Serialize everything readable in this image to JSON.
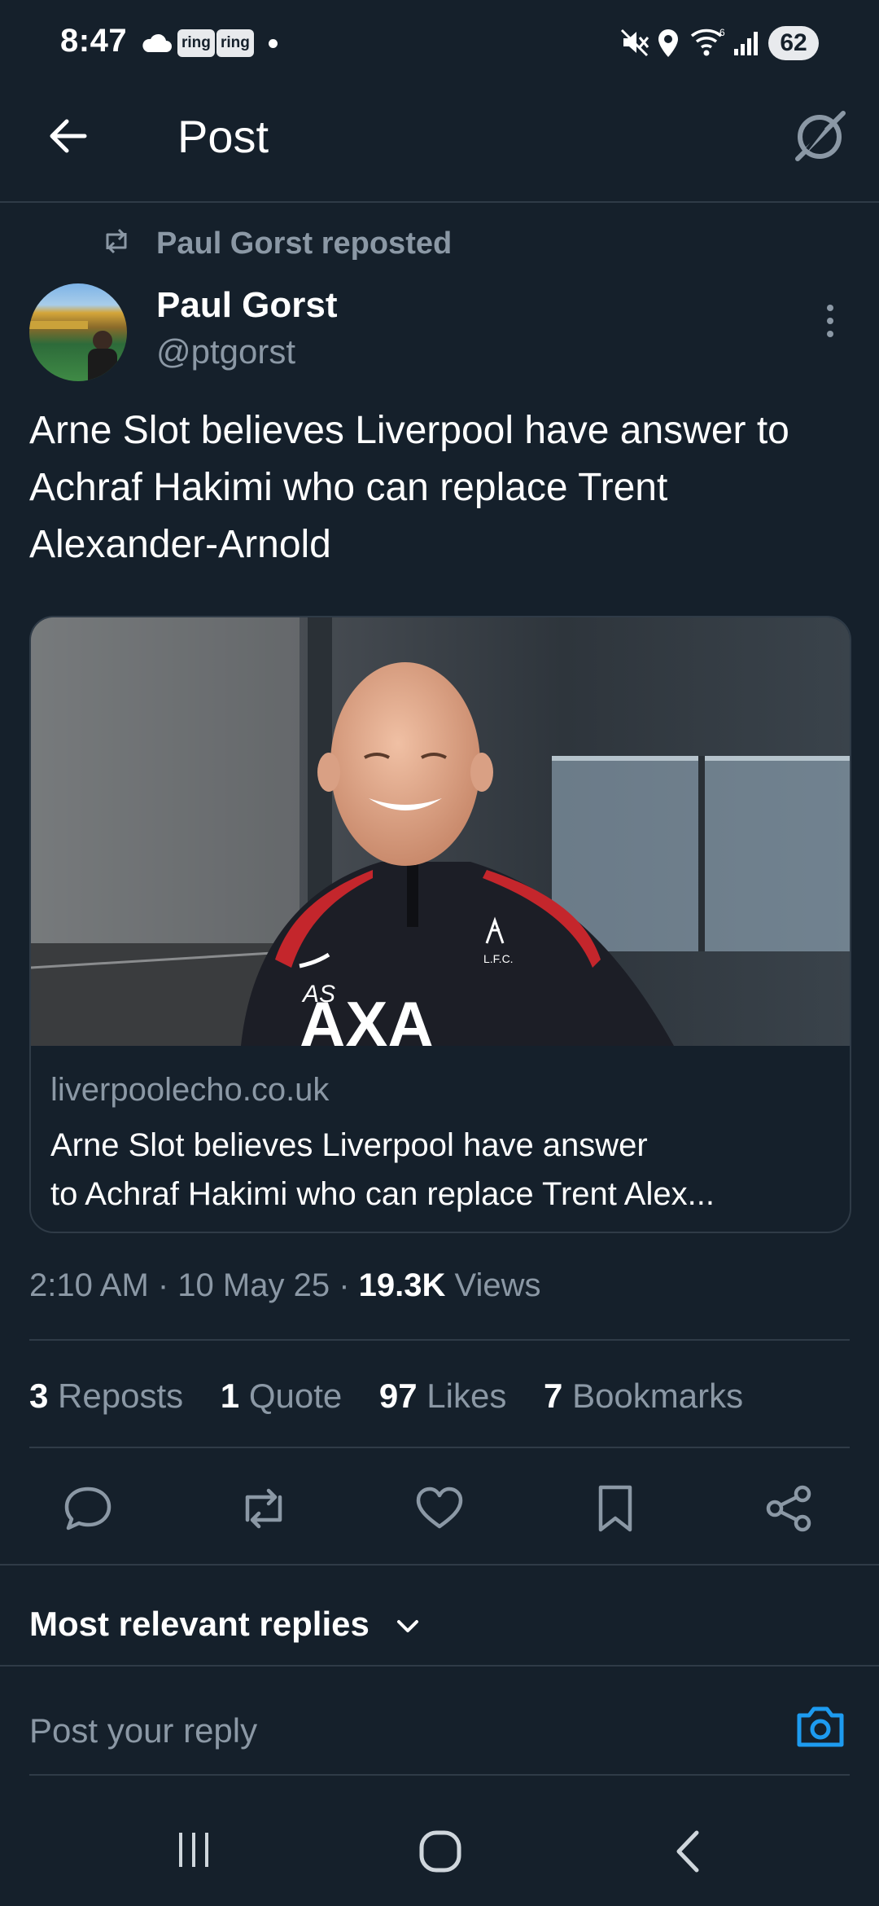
{
  "status_bar": {
    "time": "8:47",
    "ring_badge_1": "ring",
    "ring_badge_2": "ring",
    "battery": "62",
    "icons": [
      "cloud-icon",
      "ring-icon",
      "ring-icon",
      "dot-icon",
      "mute-icon",
      "location-icon",
      "wifi-icon",
      "signal-icon",
      "battery-icon"
    ]
  },
  "header": {
    "title": "Post",
    "back_icon": "back-arrow-icon",
    "grok_icon": "grok-icon"
  },
  "post": {
    "repost_label": "Paul Gorst reposted",
    "author_name": "Paul Gorst",
    "author_handle": "@ptgorst",
    "text": "Arne Slot believes Liverpool have answer to Achraf Hakimi who can replace Trent Alexander-Arnold",
    "card": {
      "domain": "liverpoolecho.co.uk",
      "title_line1": "Arne Slot believes Liverpool have answer",
      "title_line2": "to Achraf Hakimi who can replace Trent Alex...",
      "jacket_initials": "AS",
      "jacket_sponsor": "AXA",
      "jacket_crest": "L.F.C."
    },
    "timestamp": "2:10 AM · 10 May 25 · ",
    "views_count": "19.3K",
    "views_label": " Views",
    "stats": {
      "reposts_count": "3",
      "reposts_label": "Reposts",
      "quotes_count": "1",
      "quotes_label": "Quote",
      "likes_count": "97",
      "likes_label": "Likes",
      "bookmarks_count": "7",
      "bookmarks_label": "Bookmarks"
    }
  },
  "replies": {
    "sort_label": "Most relevant replies",
    "input_placeholder": "Post your reply"
  },
  "colors": {
    "background": "#15202b",
    "divider": "#2f3b47",
    "muted_text": "#8b98a5",
    "accent": "#1d9bf0"
  }
}
